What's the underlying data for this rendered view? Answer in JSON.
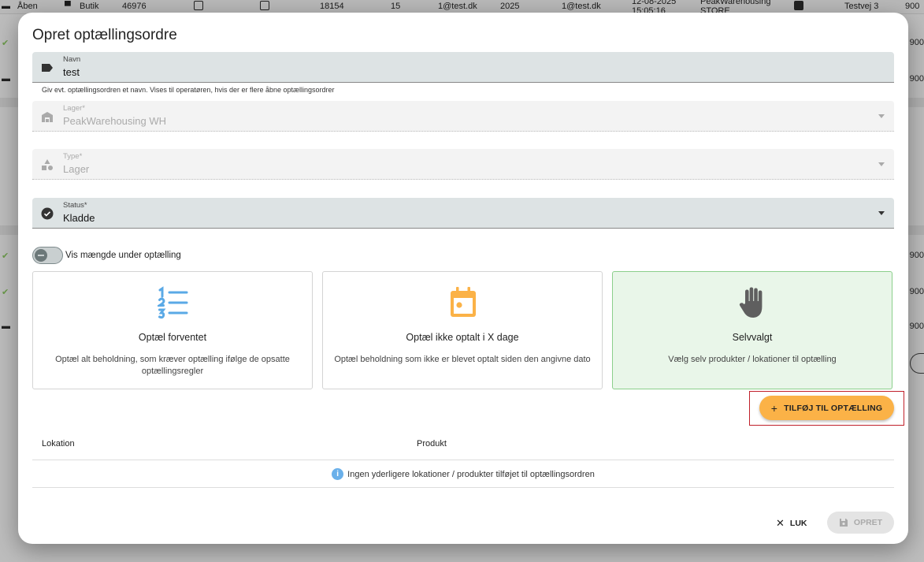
{
  "background": {
    "top_row": {
      "status": "Åben",
      "type": "Butik",
      "number": "46976",
      "qty": "18154",
      "count": "15",
      "email1": "1@test.dk",
      "year": "2025",
      "email2": "1@test.dk",
      "datetime_1": "12-08-2025",
      "datetime_2": "15:05:16",
      "warehouse_1": "PeakWarehousing",
      "warehouse_2": "STORE",
      "address": "Testvej 3",
      "right_code": "900"
    },
    "right_codes": [
      "900",
      "900",
      "900",
      "900",
      "900",
      "900"
    ]
  },
  "modal": {
    "title": "Opret optællingsordre",
    "fields": {
      "name": {
        "label": "Navn",
        "value": "test",
        "helper": "Giv evt. optællingsordren et navn. Vises til operatøren, hvis der er flere åbne optællingsordrer"
      },
      "warehouse": {
        "label": "Lager*",
        "value": "PeakWarehousing WH"
      },
      "type": {
        "label": "Type*",
        "value": "Lager"
      },
      "status": {
        "label": "Status*",
        "value": "Kladde"
      }
    },
    "toggle": {
      "label": "Vis mængde under optælling",
      "on": false
    },
    "cards": [
      {
        "title": "Optæl forventet",
        "desc": "Optæl alt beholdning, som kræver optælling ifølge de opsatte optællingsregler",
        "icon": "numbered-list-icon",
        "color": "#5aa9e6"
      },
      {
        "title": "Optæl ikke optalt i X dage",
        "desc": "Optæl beholdning som ikke er blevet optalt siden den angivne dato",
        "icon": "calendar-icon",
        "color": "#fbb247"
      },
      {
        "title": "Selvvalgt",
        "desc": "Vælg selv produkter / lokationer til optælling",
        "icon": "hand-icon",
        "color": "#5f5f5f",
        "selected": true
      }
    ],
    "add_button": "TILFØJ TIL OPTÆLLING",
    "table": {
      "columns": [
        "Lokation",
        "Produkt"
      ],
      "empty_message": "Ingen yderligere lokationer / produkter tilføjet til optællingsordren"
    },
    "footer": {
      "close_label": "LUK",
      "create_label": "OPRET"
    }
  },
  "colors": {
    "accent": "#fbb247",
    "selected_bg": "#e9f6e9",
    "highlight_frame": "#c0202a",
    "info": "#6ab0ea"
  }
}
